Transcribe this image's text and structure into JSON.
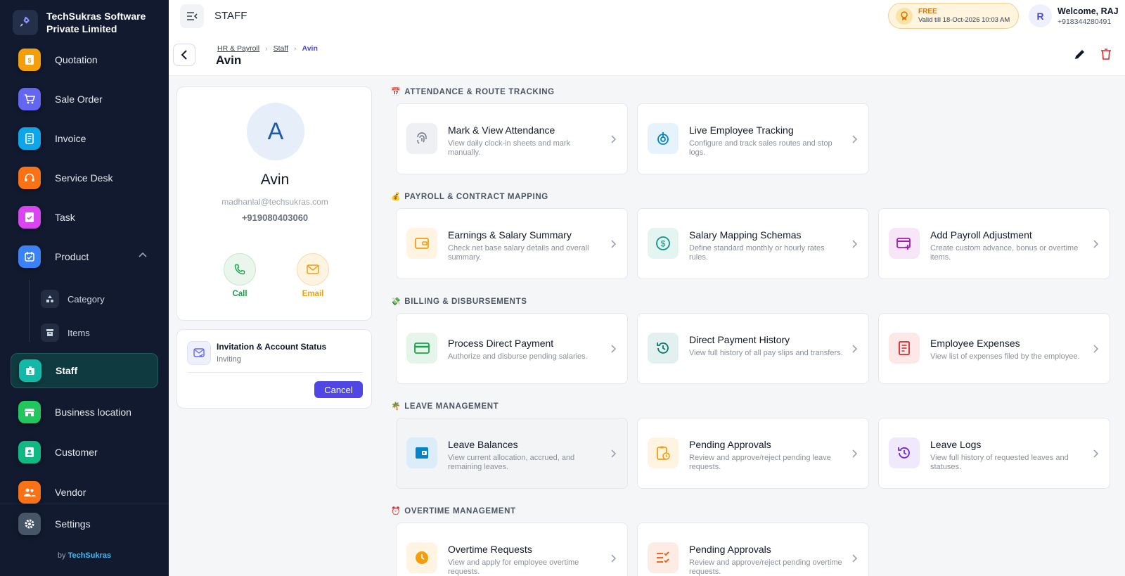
{
  "sidebar": {
    "company_name": "TechSukras Software Private Limited",
    "items": [
      {
        "label": "Quotation",
        "icon": "invoice-dollar-icon",
        "color": "#f59e0b"
      },
      {
        "label": "Sale Order",
        "icon": "cart-icon",
        "color": "#6366f1"
      },
      {
        "label": "Invoice",
        "icon": "receipt-icon",
        "color": "#0ea5e9"
      },
      {
        "label": "Service Desk",
        "icon": "headset-icon",
        "color": "#f97316"
      },
      {
        "label": "Task",
        "icon": "task-icon",
        "color": "#d946ef"
      },
      {
        "label": "Product",
        "icon": "product-icon",
        "color": "#3b82f6"
      },
      {
        "label": "Staff",
        "icon": "badge-icon",
        "color": "#14b8a6"
      },
      {
        "label": "Business location",
        "icon": "store-icon",
        "color": "#22c55e"
      },
      {
        "label": "Customer",
        "icon": "contact-card-icon",
        "color": "#10b981"
      },
      {
        "label": "Vendor",
        "icon": "people-icon",
        "color": "#f97316"
      }
    ],
    "sub_items": [
      {
        "label": "Category",
        "icon": "shapes-icon"
      },
      {
        "label": "Items",
        "icon": "archive-icon"
      }
    ],
    "settings_label": "Settings",
    "by_prefix": "by",
    "by_brand": "TechSukras"
  },
  "topbar": {
    "title": "STAFF",
    "plan": {
      "name": "FREE",
      "valid_till": "Valid till 18-Oct-2026 10:03 AM"
    },
    "user": {
      "initial": "R",
      "welcome": "Welcome, RAJ",
      "phone": "+918344280491"
    }
  },
  "breadcrumb": {
    "items": [
      "HR & Payroll",
      "Staff"
    ],
    "current": "Avin"
  },
  "page_title": "Avin",
  "profile": {
    "initial": "A",
    "name": "Avin",
    "email": "madhanlal@techsukras.com",
    "phone": "+919080403060",
    "call_label": "Call",
    "email_label": "Email"
  },
  "account_status": {
    "title": "Invitation & Account Status",
    "value": "Inviting",
    "cancel_label": "Cancel"
  },
  "sections": [
    {
      "emoji": "📅",
      "title": "ATTENDANCE & ROUTE TRACKING",
      "tiles": [
        {
          "title": "Mark & View Attendance",
          "desc": "View daily clock-in sheets and mark manually.",
          "icon": "fingerprint-icon",
          "color": "#6b7280",
          "bg": "#eef0f4"
        },
        {
          "title": "Live Employee Tracking",
          "desc": "Configure and track sales routes and stop logs.",
          "icon": "tracking-icon",
          "color": "#0284c7",
          "bg": "#e6f3fb"
        }
      ]
    },
    {
      "emoji": "💰",
      "title": "PAYROLL & CONTRACT MAPPING",
      "tiles": [
        {
          "title": "Earnings & Salary Summary",
          "desc": "Check net base salary details and overall summary.",
          "icon": "wallet-icon",
          "color": "#f59e0b",
          "bg": "#fff4e2"
        },
        {
          "title": "Salary Mapping Schemas",
          "desc": "Define standard monthly or hourly rates rules.",
          "icon": "dollar-circle-icon",
          "color": "#0d9488",
          "bg": "#e3f4f1"
        },
        {
          "title": "Add Payroll Adjustment",
          "desc": "Create custom advance, bonus or overtime items.",
          "icon": "card-add-icon",
          "color": "#a21caf",
          "bg": "#f6e6f7"
        }
      ]
    },
    {
      "emoji": "💸",
      "title": "BILLING & DISBURSEMENTS",
      "tiles": [
        {
          "title": "Process Direct Payment",
          "desc": "Authorize and disburse pending salaries.",
          "icon": "credit-card-icon",
          "color": "#16a34a",
          "bg": "#e6f5ea"
        },
        {
          "title": "Direct Payment History",
          "desc": "View full history of all pay slips and transfers.",
          "icon": "history-icon",
          "color": "#0f766e",
          "bg": "#e2f1ef"
        },
        {
          "title": "Employee Expenses",
          "desc": "View list of expenses filed by the employee.",
          "icon": "receipt-icon",
          "color": "#dc2626",
          "bg": "#fde8e8"
        }
      ]
    },
    {
      "emoji": "🌴",
      "title": "LEAVE MANAGEMENT",
      "tiles": [
        {
          "title": "Leave Balances",
          "desc": "View current allocation, accrued, and remaining leaves.",
          "icon": "wallet-icon",
          "color": "#0284c7",
          "bg": "#dcecf8"
        },
        {
          "title": "Pending Approvals",
          "desc": "Review and approve/reject pending leave requests.",
          "icon": "clipboard-clock-icon",
          "color": "#f59e0b",
          "bg": "#fff4e2"
        },
        {
          "title": "Leave Logs",
          "desc": "View full history of requested leaves and statuses.",
          "icon": "history-icon",
          "color": "#6d28d9",
          "bg": "#efe9fb"
        }
      ]
    },
    {
      "emoji": "⏰",
      "title": "OVERTIME MANAGEMENT",
      "tiles": [
        {
          "title": "Overtime Requests",
          "desc": "View and apply for employee overtime requests.",
          "icon": "clock-icon",
          "color": "#f59e0b",
          "bg": "#fff4e2"
        },
        {
          "title": "Pending Approvals",
          "desc": "Review and approve/reject pending overtime requests.",
          "icon": "checklist-icon",
          "color": "#ea580c",
          "bg": "#fdece4"
        }
      ]
    }
  ]
}
